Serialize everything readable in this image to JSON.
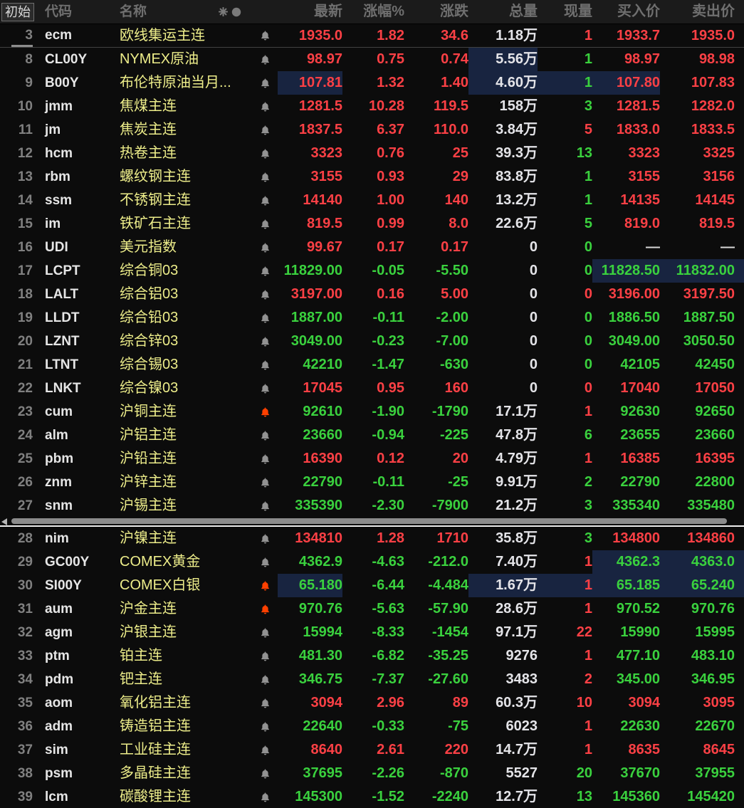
{
  "colors": {
    "up": "#fb4045",
    "down": "#3ad13e",
    "neutral": "#d8d8d8",
    "volume_white": "#e4e4e8",
    "name_yellow": "#eded8a",
    "highlight_bg": "#182440",
    "bell_gray": "#929292",
    "bell_alert": "#fe4000"
  },
  "header": {
    "col_init": "初始",
    "col_code": "代码",
    "col_name": "名称",
    "col_last": "最新",
    "col_pct": "涨幅%",
    "col_chg": "涨跌",
    "col_vol": "总量",
    "col_cur": "现量",
    "col_bid": "买入价",
    "col_ask": "卖出价",
    "icons": {
      "star": "star-icon",
      "dot": "circle-icon"
    }
  },
  "panes": {
    "top": [
      {
        "n": "3",
        "code": "ecm",
        "name": "欧线集运主连",
        "bell": "gray",
        "last": "1935.0",
        "pct": "1.82",
        "chg": "34.6",
        "vol": "1.18万",
        "cur": "1",
        "bid": "1933.7",
        "ask": "1935.0",
        "dir": "up",
        "cur_dir": "up",
        "hl": [],
        "sel": true
      },
      {
        "n": "8",
        "code": "CL00Y",
        "name": "NYMEX原油",
        "bell": "gray",
        "last": "98.97",
        "pct": "0.75",
        "chg": "0.74",
        "vol": "5.56万",
        "cur": "1",
        "bid": "98.97",
        "ask": "98.98",
        "dir": "up",
        "cur_dir": "down",
        "hl": [
          "vol"
        ]
      },
      {
        "n": "9",
        "code": "B00Y",
        "name": "布伦特原油当月...",
        "bell": "gray",
        "last": "107.81",
        "pct": "1.32",
        "chg": "1.40",
        "vol": "4.60万",
        "cur": "1",
        "bid": "107.80",
        "ask": "107.83",
        "dir": "up",
        "cur_dir": "down",
        "hl": [
          "last",
          "vol",
          "cur",
          "bid"
        ]
      },
      {
        "n": "10",
        "code": "jmm",
        "name": "焦煤主连",
        "bell": "gray",
        "last": "1281.5",
        "pct": "10.28",
        "chg": "119.5",
        "vol": "158万",
        "cur": "3",
        "bid": "1281.5",
        "ask": "1282.0",
        "dir": "up",
        "cur_dir": "down",
        "hl": []
      },
      {
        "n": "11",
        "code": "jm",
        "name": "焦炭主连",
        "bell": "gray",
        "last": "1837.5",
        "pct": "6.37",
        "chg": "110.0",
        "vol": "3.84万",
        "cur": "5",
        "bid": "1833.0",
        "ask": "1833.5",
        "dir": "up",
        "cur_dir": "up",
        "hl": []
      },
      {
        "n": "12",
        "code": "hcm",
        "name": "热卷主连",
        "bell": "gray",
        "last": "3323",
        "pct": "0.76",
        "chg": "25",
        "vol": "39.3万",
        "cur": "13",
        "bid": "3323",
        "ask": "3325",
        "dir": "up",
        "cur_dir": "down",
        "hl": []
      },
      {
        "n": "13",
        "code": "rbm",
        "name": "螺纹钢主连",
        "bell": "gray",
        "last": "3155",
        "pct": "0.93",
        "chg": "29",
        "vol": "83.8万",
        "cur": "1",
        "bid": "3155",
        "ask": "3156",
        "dir": "up",
        "cur_dir": "down",
        "hl": []
      },
      {
        "n": "14",
        "code": "ssm",
        "name": "不锈钢主连",
        "bell": "gray",
        "last": "14140",
        "pct": "1.00",
        "chg": "140",
        "vol": "13.2万",
        "cur": "1",
        "bid": "14135",
        "ask": "14145",
        "dir": "up",
        "cur_dir": "down",
        "hl": []
      },
      {
        "n": "15",
        "code": "im",
        "name": "铁矿石主连",
        "bell": "gray",
        "last": "819.5",
        "pct": "0.99",
        "chg": "8.0",
        "vol": "22.6万",
        "cur": "5",
        "bid": "819.0",
        "ask": "819.5",
        "dir": "up",
        "cur_dir": "down",
        "hl": []
      },
      {
        "n": "16",
        "code": "UDI",
        "name": "美元指数",
        "bell": "gray",
        "last": "99.67",
        "pct": "0.17",
        "chg": "0.17",
        "vol": "0",
        "cur": "0",
        "bid": "—",
        "ask": "—",
        "dir": "up",
        "cur_dir": "down",
        "ba_dir": "neutral",
        "hl": []
      },
      {
        "n": "17",
        "code": "LCPT",
        "name": "综合铜03",
        "bell": "gray",
        "last": "11829.00",
        "pct": "-0.05",
        "chg": "-5.50",
        "vol": "0",
        "cur": "0",
        "bid": "11828.50",
        "ask": "11832.00",
        "dir": "down",
        "cur_dir": "down",
        "hl": [
          "bid",
          "ask"
        ]
      },
      {
        "n": "18",
        "code": "LALT",
        "name": "综合铝03",
        "bell": "gray",
        "last": "3197.00",
        "pct": "0.16",
        "chg": "5.00",
        "vol": "0",
        "cur": "0",
        "bid": "3196.00",
        "ask": "3197.50",
        "dir": "up",
        "cur_dir": "up",
        "hl": []
      },
      {
        "n": "19",
        "code": "LLDT",
        "name": "综合铅03",
        "bell": "gray",
        "last": "1887.00",
        "pct": "-0.11",
        "chg": "-2.00",
        "vol": "0",
        "cur": "0",
        "bid": "1886.50",
        "ask": "1887.50",
        "dir": "down",
        "cur_dir": "down",
        "hl": []
      },
      {
        "n": "20",
        "code": "LZNT",
        "name": "综合锌03",
        "bell": "gray",
        "last": "3049.00",
        "pct": "-0.23",
        "chg": "-7.00",
        "vol": "0",
        "cur": "0",
        "bid": "3049.00",
        "ask": "3050.50",
        "dir": "down",
        "cur_dir": "down",
        "hl": []
      },
      {
        "n": "21",
        "code": "LTNT",
        "name": "综合锡03",
        "bell": "gray",
        "last": "42210",
        "pct": "-1.47",
        "chg": "-630",
        "vol": "0",
        "cur": "0",
        "bid": "42105",
        "ask": "42450",
        "dir": "down",
        "cur_dir": "down",
        "hl": []
      },
      {
        "n": "22",
        "code": "LNKT",
        "name": "综合镍03",
        "bell": "gray",
        "last": "17045",
        "pct": "0.95",
        "chg": "160",
        "vol": "0",
        "cur": "0",
        "bid": "17040",
        "ask": "17050",
        "dir": "up",
        "cur_dir": "up",
        "hl": []
      },
      {
        "n": "23",
        "code": "cum",
        "name": "沪铜主连",
        "bell": "alert",
        "last": "92610",
        "pct": "-1.90",
        "chg": "-1790",
        "vol": "17.1万",
        "cur": "1",
        "bid": "92630",
        "ask": "92650",
        "dir": "down",
        "cur_dir": "up",
        "hl": []
      },
      {
        "n": "24",
        "code": "alm",
        "name": "沪铝主连",
        "bell": "gray",
        "last": "23660",
        "pct": "-0.94",
        "chg": "-225",
        "vol": "47.8万",
        "cur": "6",
        "bid": "23655",
        "ask": "23660",
        "dir": "down",
        "cur_dir": "down",
        "hl": []
      },
      {
        "n": "25",
        "code": "pbm",
        "name": "沪铅主连",
        "bell": "gray",
        "last": "16390",
        "pct": "0.12",
        "chg": "20",
        "vol": "4.79万",
        "cur": "1",
        "bid": "16385",
        "ask": "16395",
        "dir": "up",
        "cur_dir": "up",
        "hl": []
      },
      {
        "n": "26",
        "code": "znm",
        "name": "沪锌主连",
        "bell": "gray",
        "last": "22790",
        "pct": "-0.11",
        "chg": "-25",
        "vol": "9.91万",
        "cur": "2",
        "bid": "22790",
        "ask": "22800",
        "dir": "down",
        "cur_dir": "down",
        "hl": []
      },
      {
        "n": "27",
        "code": "snm",
        "name": "沪锡主连",
        "bell": "gray",
        "last": "335390",
        "pct": "-2.30",
        "chg": "-7900",
        "vol": "21.2万",
        "cur": "3",
        "bid": "335340",
        "ask": "335480",
        "dir": "down",
        "cur_dir": "down",
        "hl": []
      }
    ],
    "bottom": [
      {
        "n": "28",
        "code": "nim",
        "name": "沪镍主连",
        "bell": "gray",
        "last": "134810",
        "pct": "1.28",
        "chg": "1710",
        "vol": "35.8万",
        "cur": "3",
        "bid": "134800",
        "ask": "134860",
        "dir": "up",
        "cur_dir": "down",
        "hl": []
      },
      {
        "n": "29",
        "code": "GC00Y",
        "name": "COMEX黄金",
        "bell": "gray",
        "last": "4362.9",
        "pct": "-4.63",
        "chg": "-212.0",
        "vol": "7.40万",
        "cur": "1",
        "bid": "4362.3",
        "ask": "4363.0",
        "dir": "down",
        "cur_dir": "up",
        "hl": [
          "bid",
          "ask"
        ]
      },
      {
        "n": "30",
        "code": "SI00Y",
        "name": "COMEX白银",
        "bell": "alert",
        "last": "65.180",
        "pct": "-6.44",
        "chg": "-4.484",
        "vol": "1.67万",
        "cur": "1",
        "bid": "65.185",
        "ask": "65.240",
        "dir": "down",
        "cur_dir": "up",
        "hl": [
          "last",
          "vol",
          "cur",
          "bid",
          "ask"
        ]
      },
      {
        "n": "31",
        "code": "aum",
        "name": "沪金主连",
        "bell": "alert",
        "last": "970.76",
        "pct": "-5.63",
        "chg": "-57.90",
        "vol": "28.6万",
        "cur": "1",
        "bid": "970.52",
        "ask": "970.76",
        "dir": "down",
        "cur_dir": "up",
        "hl": []
      },
      {
        "n": "32",
        "code": "agm",
        "name": "沪银主连",
        "bell": "gray",
        "last": "15994",
        "pct": "-8.33",
        "chg": "-1454",
        "vol": "97.1万",
        "cur": "22",
        "bid": "15990",
        "ask": "15995",
        "dir": "down",
        "cur_dir": "up",
        "hl": []
      },
      {
        "n": "33",
        "code": "ptm",
        "name": "铂主连",
        "bell": "gray",
        "last": "481.30",
        "pct": "-6.82",
        "chg": "-35.25",
        "vol": "9276",
        "cur": "1",
        "bid": "477.10",
        "ask": "483.10",
        "dir": "down",
        "cur_dir": "up",
        "hl": []
      },
      {
        "n": "34",
        "code": "pdm",
        "name": "钯主连",
        "bell": "gray",
        "last": "346.75",
        "pct": "-7.37",
        "chg": "-27.60",
        "vol": "3483",
        "cur": "2",
        "bid": "345.00",
        "ask": "346.95",
        "dir": "down",
        "cur_dir": "up",
        "hl": []
      },
      {
        "n": "35",
        "code": "aom",
        "name": "氧化铝主连",
        "bell": "gray",
        "last": "3094",
        "pct": "2.96",
        "chg": "89",
        "vol": "60.3万",
        "cur": "10",
        "bid": "3094",
        "ask": "3095",
        "dir": "up",
        "cur_dir": "up",
        "hl": []
      },
      {
        "n": "36",
        "code": "adm",
        "name": "铸造铝主连",
        "bell": "gray",
        "last": "22640",
        "pct": "-0.33",
        "chg": "-75",
        "vol": "6023",
        "cur": "1",
        "bid": "22630",
        "ask": "22670",
        "dir": "down",
        "cur_dir": "up",
        "hl": []
      },
      {
        "n": "37",
        "code": "sim",
        "name": "工业硅主连",
        "bell": "gray",
        "last": "8640",
        "pct": "2.61",
        "chg": "220",
        "vol": "14.7万",
        "cur": "1",
        "bid": "8635",
        "ask": "8645",
        "dir": "up",
        "cur_dir": "up",
        "hl": []
      },
      {
        "n": "38",
        "code": "psm",
        "name": "多晶硅主连",
        "bell": "gray",
        "last": "37695",
        "pct": "-2.26",
        "chg": "-870",
        "vol": "5527",
        "cur": "20",
        "bid": "37670",
        "ask": "37955",
        "dir": "down",
        "cur_dir": "down",
        "hl": []
      },
      {
        "n": "39",
        "code": "lcm",
        "name": "碳酸锂主连",
        "bell": "gray",
        "last": "145300",
        "pct": "-1.52",
        "chg": "-2240",
        "vol": "12.7万",
        "cur": "13",
        "bid": "145360",
        "ask": "145420",
        "dir": "down",
        "cur_dir": "down",
        "hl": []
      }
    ]
  }
}
